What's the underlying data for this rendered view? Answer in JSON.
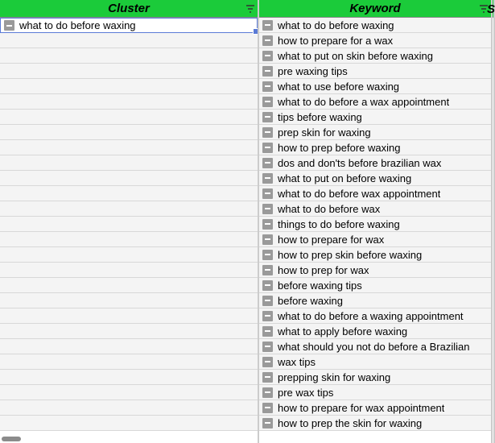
{
  "columns": {
    "cluster": "Cluster",
    "keyword": "Keyword",
    "extra_letter": "S"
  },
  "cluster_rows": [
    {
      "text": "what to do before waxing",
      "selected": true
    }
  ],
  "cluster_empty_row_count": 26,
  "keyword_rows": [
    "what to do before waxing",
    "how to prepare for a wax",
    "what to put on skin before waxing",
    "pre waxing tips",
    "what to use before waxing",
    "what to do before a wax appointment",
    "tips before waxing",
    "prep skin for waxing",
    "how to prep before waxing",
    "dos and don'ts before brazilian wax",
    "what to put on before waxing",
    "what to do before wax appointment",
    "what to do before wax",
    "things to do before waxing",
    "how to prepare for wax",
    "how to prep skin before waxing",
    "how to prep for wax",
    "before waxing tips",
    "before waxing",
    "what to do before a waxing appointment",
    "what to apply before waxing",
    "what should you not do before a Brazilian",
    "wax tips",
    "prepping skin for waxing",
    "pre wax tips",
    "how to prepare for wax appointment",
    "how to prep the skin for waxing"
  ]
}
